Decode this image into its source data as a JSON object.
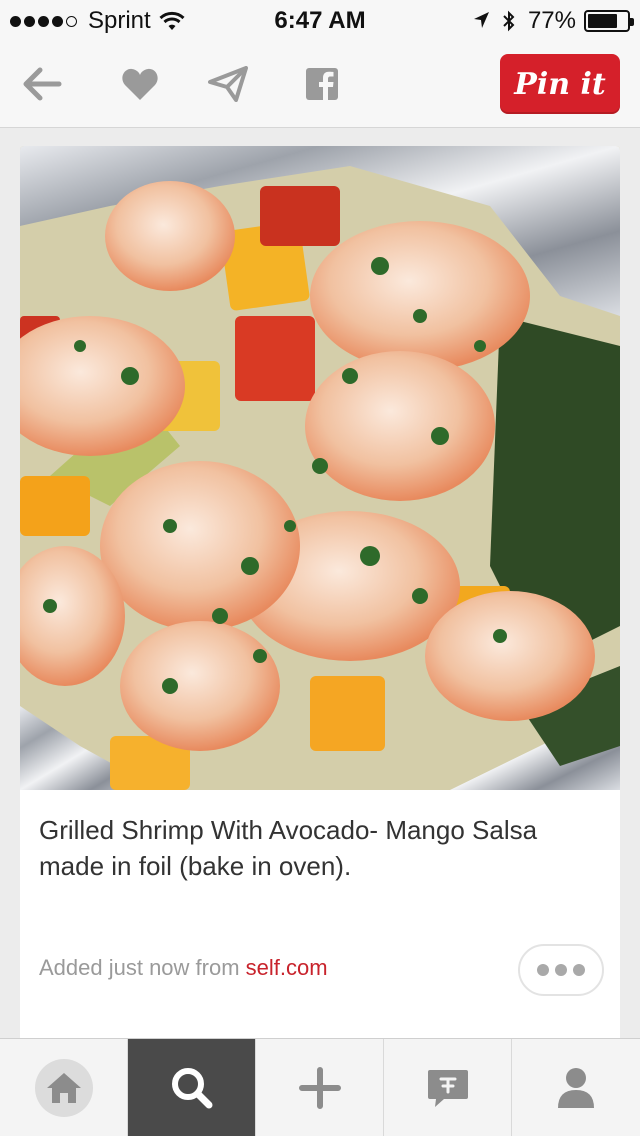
{
  "status_bar": {
    "carrier": "Sprint",
    "signal_bars_filled": 4,
    "signal_bars_total": 5,
    "time": "6:47 AM",
    "battery_text": "77%",
    "battery_level": 0.77,
    "icons": [
      "wifi-icon",
      "location-arrow-icon",
      "bluetooth-icon",
      "battery-icon"
    ]
  },
  "toolbar": {
    "icons": [
      "back-arrow-icon",
      "heart-icon",
      "send-icon",
      "facebook-icon"
    ],
    "pin_it_label": "Pin it",
    "pin_it_color": "#d5202a"
  },
  "pin": {
    "image_subject": "shrimp-couscous-foil-photo",
    "description": "Grilled Shrimp With Avocado- Mango Salsa made in foil (bake in oven).",
    "source_prefix": "Added just now from ",
    "source_domain": "self.com",
    "source_color": "#c8232c"
  },
  "tab_bar": {
    "tabs": [
      "home-icon",
      "search-icon",
      "plus-icon",
      "news-icon",
      "profile-icon"
    ],
    "active_tab": "search-icon"
  }
}
